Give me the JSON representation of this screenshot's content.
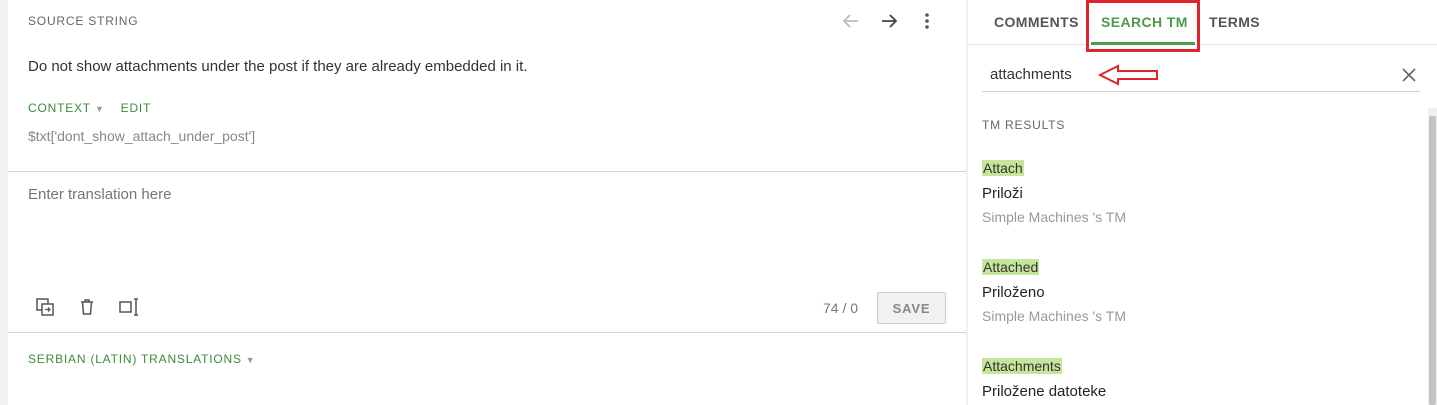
{
  "editor": {
    "source_header": "SOURCE STRING",
    "source_text": "Do not show attachments under the post if they are already embedded in it.",
    "context_label": "CONTEXT",
    "edit_label": "EDIT",
    "string_key": "$txt['dont_show_attach_under_post']",
    "translation_placeholder": "Enter translation here",
    "counter": "74 / 0",
    "save_label": "SAVE",
    "translations_header": "SERBIAN (LATIN) TRANSLATIONS"
  },
  "sidebar": {
    "tabs": [
      {
        "label": "COMMENTS"
      },
      {
        "label": "SEARCH TM"
      },
      {
        "label": "TERMS"
      }
    ],
    "search_value": "attachments",
    "tm_header": "TM RESULTS",
    "results": [
      {
        "term": "Attach",
        "translation": "Priloži",
        "source": "Simple Machines 's TM"
      },
      {
        "term": "Attached",
        "translation": "Priloženo",
        "source": "Simple Machines 's TM"
      },
      {
        "term": "Attachments",
        "translation": "Priložene datoteke",
        "source": ""
      }
    ]
  },
  "colors": {
    "accent_green": "#4a9b4a",
    "annotation_red": "#e0242b",
    "highlight": "#c5e59a"
  }
}
